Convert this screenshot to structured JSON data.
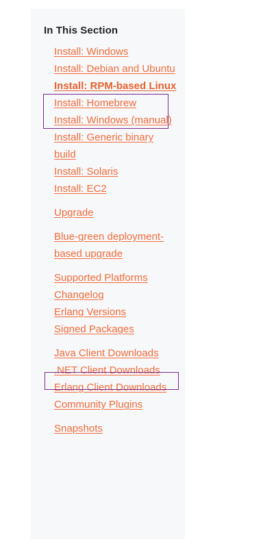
{
  "sidebar": {
    "title": "In This Section",
    "groups": [
      {
        "items": [
          {
            "label": "Install: Windows",
            "active": false
          },
          {
            "label": "Install: Debian and Ubuntu",
            "active": false
          },
          {
            "label": "Install: RPM-based Linux",
            "active": true
          },
          {
            "label": "Install: Homebrew",
            "active": false
          },
          {
            "label": "Install: Windows (manual)",
            "active": false
          },
          {
            "label": "Install: Generic binary build",
            "active": false
          },
          {
            "label": "Install: Solaris",
            "active": false
          },
          {
            "label": "Install: EC2",
            "active": false
          }
        ]
      },
      {
        "items": [
          {
            "label": "Upgrade",
            "active": false
          }
        ]
      },
      {
        "items": [
          {
            "label": "Blue-green deployment-based upgrade",
            "active": false
          }
        ]
      },
      {
        "items": [
          {
            "label": "Supported Platforms",
            "active": false
          },
          {
            "label": "Changelog",
            "active": false
          },
          {
            "label": "Erlang Versions",
            "active": false
          },
          {
            "label": "Signed Packages",
            "active": false
          }
        ]
      },
      {
        "items": [
          {
            "label": "Java Client Downloads",
            "active": false
          },
          {
            "label": ".NET Client Downloads",
            "active": false
          },
          {
            "label": "Erlang Client Downloads",
            "active": false
          },
          {
            "label": "Community Plugins",
            "active": false
          }
        ]
      },
      {
        "items": [
          {
            "label": "Snapshots",
            "active": false
          }
        ]
      }
    ]
  },
  "colors": {
    "link": "#f26b3a",
    "highlight_border": "#7b2a8a",
    "sidebar_bg": "#f7f8fa"
  }
}
